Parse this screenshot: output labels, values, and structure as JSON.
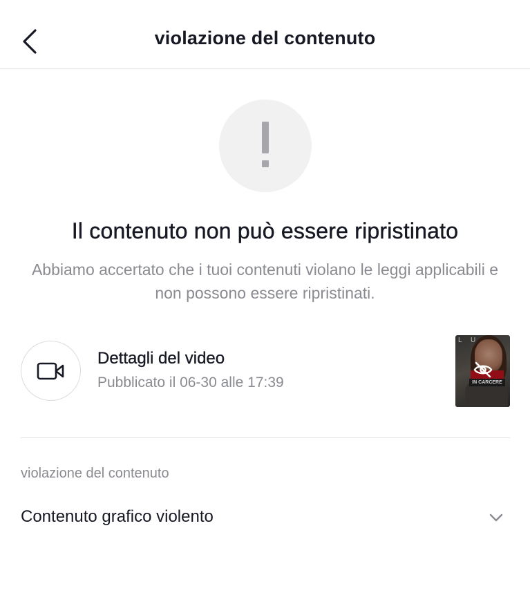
{
  "header": {
    "title": "violazione del contenuto",
    "back_icon": "chevron-left-icon"
  },
  "alert": {
    "icon": "exclamation-icon",
    "heading": "Il contenuto non può essere ripristinato",
    "description": "Abbiamo accertato che i tuoi contenuti violano le leggi applicabili e non possono essere ripristinati."
  },
  "video": {
    "icon": "video-camera-icon",
    "title": "Dettagli del video",
    "published": "Pubblicato il 06-30 alle 17:39",
    "thumbnail": {
      "corner_text": "L U",
      "banner_text": "IN CARCERE",
      "overlay_icon": "eye-slash-icon"
    }
  },
  "violation": {
    "section_label": "violazione del contenuto",
    "category": "Contenuto grafico violento",
    "expand_icon": "chevron-down-icon"
  },
  "colors": {
    "text_primary": "#161823",
    "text_secondary": "#8a8b91",
    "divider": "#e3e3e4",
    "alert_bg": "#f1f1f2",
    "alert_mark": "#a7a7ab"
  }
}
